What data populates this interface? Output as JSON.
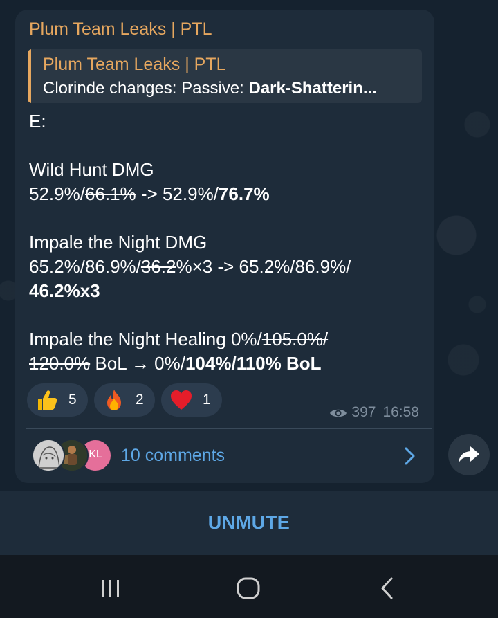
{
  "message": {
    "sender": "Plum Team Leaks | PTL",
    "reply": {
      "title": "Plum Team Leaks | PTL",
      "text_prefix": "Clorinde changes:  Passive: ",
      "text_bold": "Dark-Shatterin..."
    },
    "lines": {
      "e_heading": "E:",
      "wild_hunt_label": "Wild Hunt DMG",
      "wild_hunt_a": "52.9%/",
      "wild_hunt_old": "66.1%",
      "wild_hunt_b": " -> 52.9%/",
      "wild_hunt_new": "76.7%",
      "impale_label": "Impale the Night DMG",
      "impale_a": "65.2%/86.9%/",
      "impale_old": "36.2",
      "impale_b": "%×3 -> 65.2%/86.9%/",
      "impale_new": "46.2%x3",
      "heal_label_a": "Impale the Night Healing 0%/",
      "heal_old_1": "105.0%/",
      "heal_old_2": "120.0%",
      "heal_b": " BoL → 0%/",
      "heal_new": "104%/110% BoL"
    },
    "reactions": [
      {
        "emoji": "thumbs-up",
        "count": "5"
      },
      {
        "emoji": "fire",
        "count": "2"
      },
      {
        "emoji": "heart",
        "count": "1"
      }
    ],
    "views": "397",
    "time": "16:58",
    "comments_label": "10 comments",
    "commenter_initials": "KL"
  },
  "bottom": {
    "unmute_label": "UNMUTE"
  },
  "colors": {
    "accent": "#e6a75f",
    "link": "#5ea8e6",
    "bubble": "#1e2c3a"
  }
}
